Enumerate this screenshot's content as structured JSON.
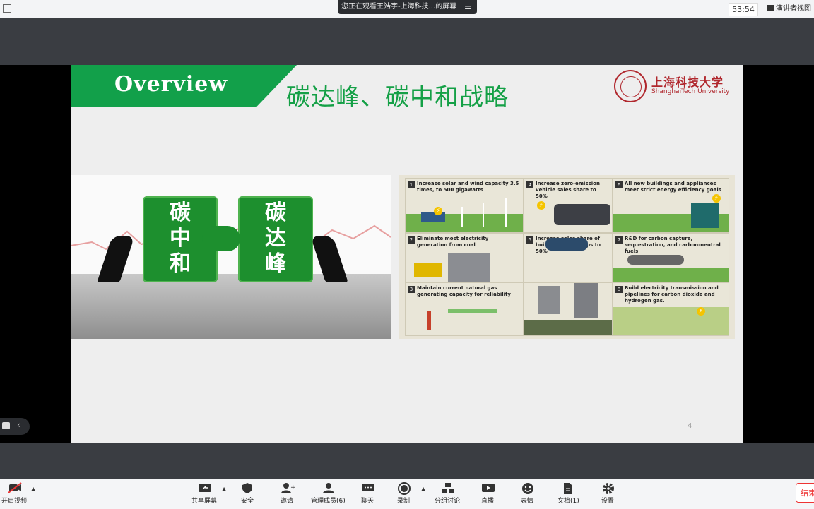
{
  "topbar": {
    "share_banner": "您正在观看王浩宇-上海科技...的屏幕",
    "timer": "53:54",
    "presenter_view": "演讲者视图"
  },
  "slide": {
    "header_label": "Overview",
    "title": "碳达峰、碳中和战略",
    "university_cn": "上海科技大学",
    "university_en": "ShanghaiTech University",
    "page_number": "4",
    "puzzle_left": [
      "碳",
      "中",
      "和"
    ],
    "puzzle_right": [
      "碳",
      "达",
      "峰"
    ],
    "infographic": [
      {
        "num": "1",
        "text": "Increase solar and wind capacity 3.5 times, to 500 gigawatts"
      },
      {
        "num": "2",
        "text": "Eliminate most electricity generation from coal"
      },
      {
        "num": "3",
        "text": "Maintain current natural gas generating capacity for reliability"
      },
      {
        "num": "4",
        "text": "Increase zero-emission vehicle sales share to 50%"
      },
      {
        "num": "5",
        "text": "Increase sales share of building heat pumps to 50%"
      },
      {
        "num": "6",
        "text": "All new buildings and appliances meet strict energy efficiency goals"
      },
      {
        "num": "7",
        "text": "R&D for carbon capture, sequestration, and carbon-neutral fuels"
      },
      {
        "num": "8",
        "text": "Build electricity transmission and pipelines for carbon dioxide and hydrogen gas."
      }
    ]
  },
  "toolbar": {
    "video": "开启视频",
    "share_screen": "共享屏幕",
    "security": "安全",
    "invite": "邀请",
    "manage_members": "管理成员(6)",
    "chat": "聊天",
    "record": "录制",
    "breakout": "分组讨论",
    "live": "直播",
    "reactions": "表情",
    "documents": "文档(1)",
    "settings": "设置",
    "end": "结束"
  }
}
